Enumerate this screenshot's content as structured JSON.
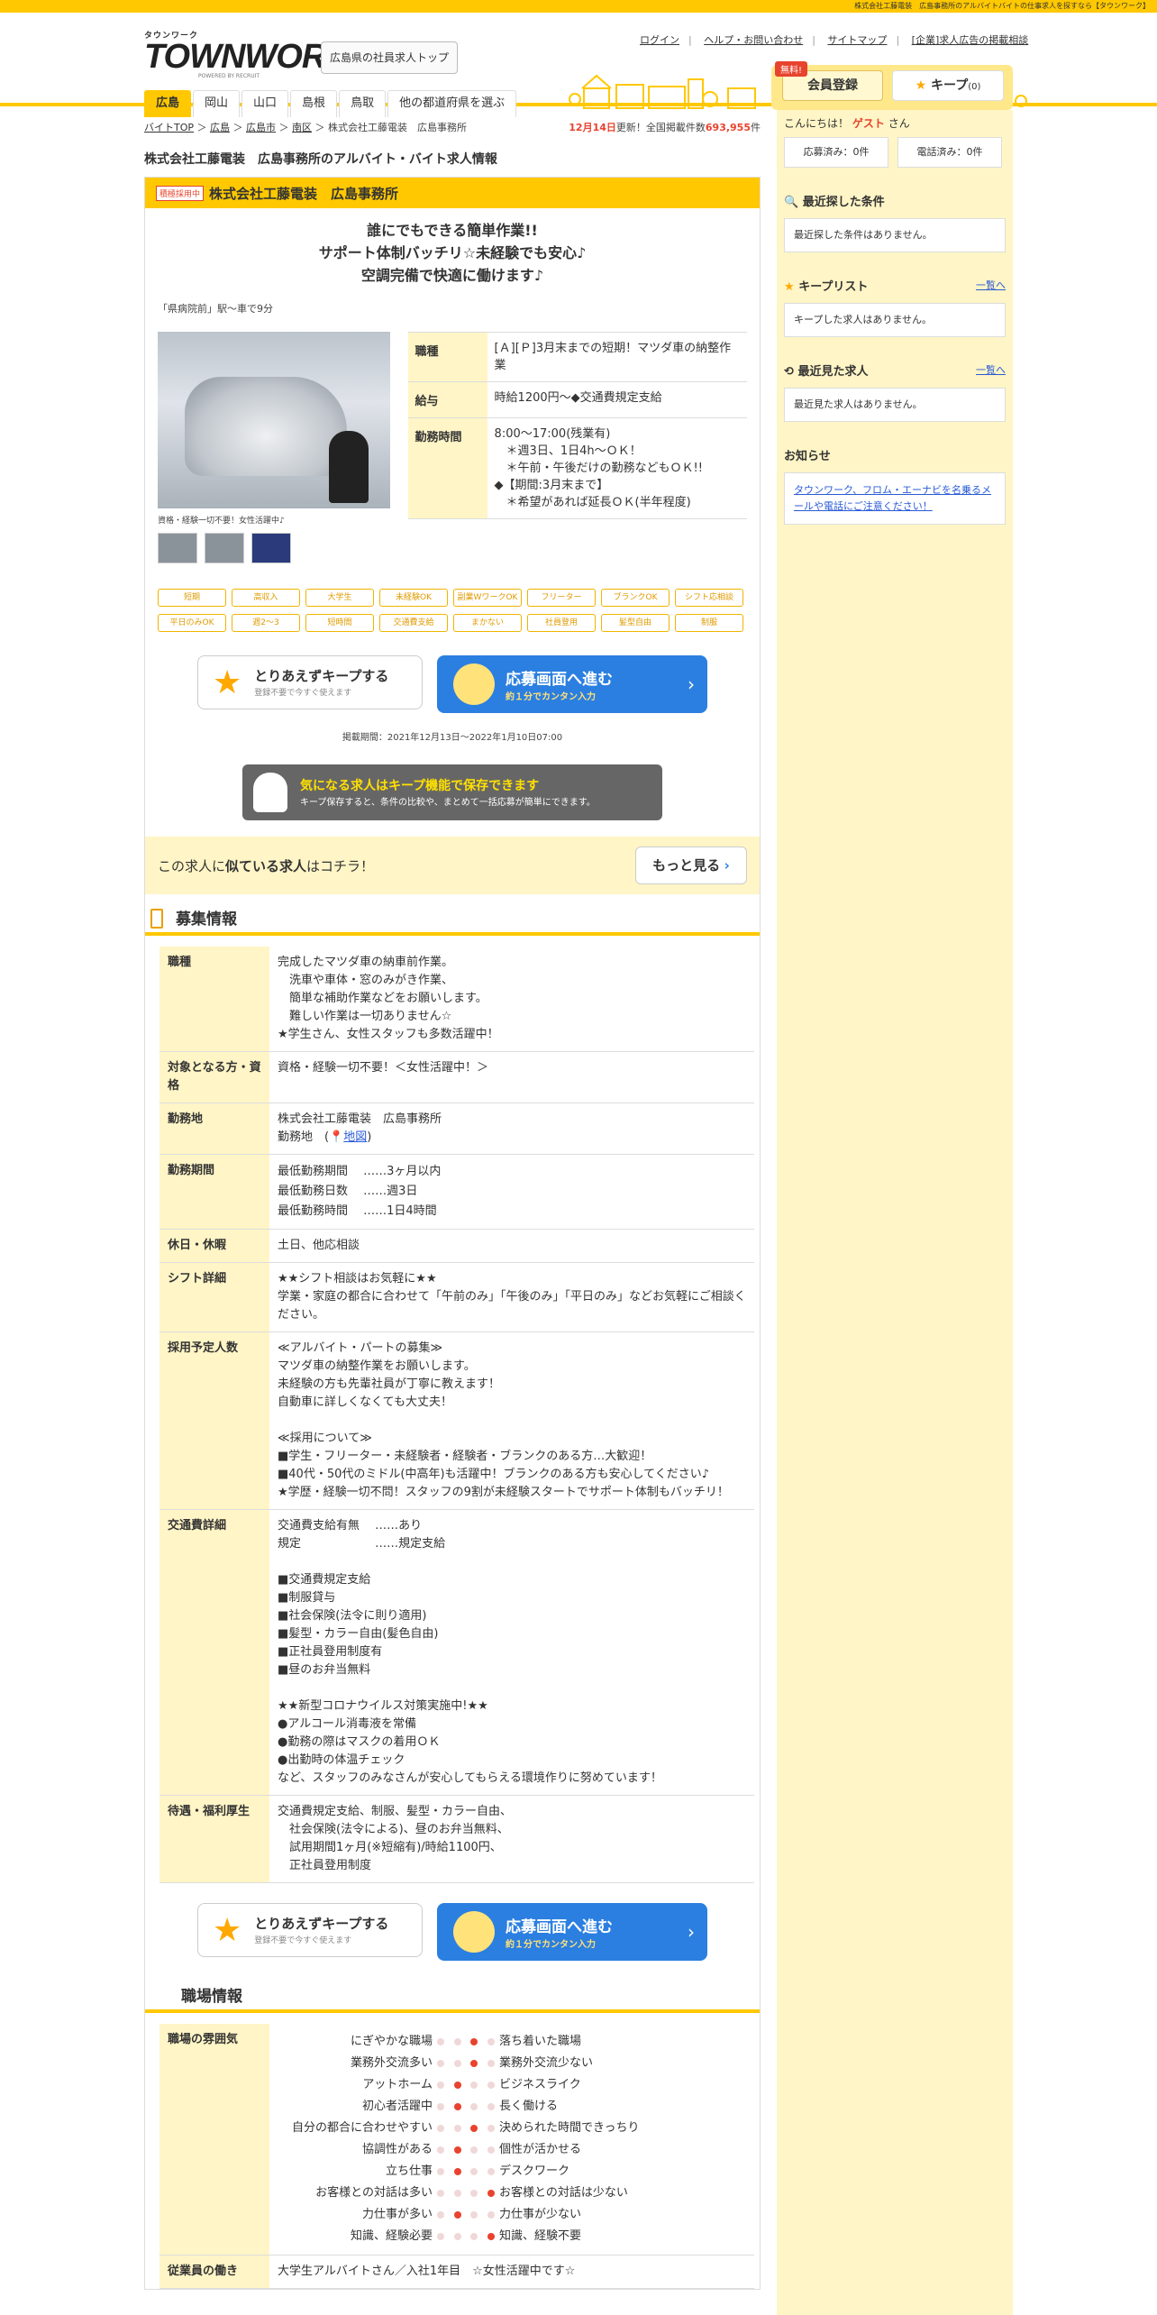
{
  "topbar": "株式会社工藤電装　広島事務所のアルバイトバイトの仕事求人を探すなら【タウンワーク】",
  "logo": {
    "small": "タウンワーク",
    "big": "TOWNWORK",
    "pw": "POWERED BY RECRUIT"
  },
  "header": {
    "top_button": "広島県の社員求人トップ",
    "links": [
      "ログイン",
      "ヘルプ・お問い合わせ",
      "サイトマップ",
      "[企業]求人広告の掲載相談"
    ],
    "tabs": [
      "広島",
      "岡山",
      "山口",
      "島根",
      "鳥取",
      "他の都道府県を選ぶ"
    ],
    "free": "無料!",
    "register": "会員登録",
    "keep": "キープ",
    "keep_count": "(0)"
  },
  "breadcrumb": [
    "バイトTOP",
    "広島",
    "広島市",
    "南区",
    "株式会社工藤電装　広島事務所"
  ],
  "update": {
    "date": "12月14日",
    "mid": "更新！全国掲載件数",
    "count": "693,955",
    "suffix": "件"
  },
  "page_title": "株式会社工藤電装　広島事務所のアルバイト・バイト求人情報",
  "job": {
    "badge": "積極採用中",
    "company": "株式会社工藤電装　広島事務所",
    "catch": [
      "誰にでもできる簡単作業!!",
      "サポート体制バッチリ☆未経験でも安心♪",
      "空調完備で快適に働けます♪"
    ],
    "station": "「県病院前」駅～車で9分",
    "photo_caption": "資格・経験一切不要！女性活躍中♪",
    "spec": [
      {
        "k": "職種",
        "v": "[Ａ][Ｐ]3月末までの短期！マツダ車の納整作業"
      },
      {
        "k": "給与",
        "v": "時給1200円～◆交通費規定支給"
      },
      {
        "k": "勤務時間",
        "v": "8:00～17:00(残業有)\n　＊週3日、1日4h～ＯＫ！\n　＊午前・午後だけの勤務などもＯＫ!!\n◆【期間:3月末まで】\n　＊希望があれば延長ＯＫ(半年程度)"
      }
    ],
    "tags": [
      "短期",
      "高収入",
      "大学生",
      "未経験OK",
      "副業WワークOK",
      "フリーター",
      "ブランクOK",
      "シフト応相談",
      "平日のみOK",
      "週2～3",
      "短時間",
      "交通費支給",
      "まかない",
      "社員登用",
      "髪型自由",
      "制服"
    ],
    "keep_btn": {
      "title": "とりあえずキープする",
      "sub": "登録不要で今すぐ使えます"
    },
    "apply_btn": {
      "title": "応募画面へ進む",
      "sub": "約１分でカンタン入力"
    },
    "period": "掲載期間：2021年12月13日～2022年1月10日07:00",
    "banner": {
      "title": "気になる求人はキープ機能で保存できます",
      "sub": "キープ保存すると、条件の比較や、まとめて一括応募が簡単にできます。"
    },
    "similar": {
      "pre": "この求人に",
      "bold": "似ている求人",
      "post": "はコチラ！",
      "more": "もっと見る"
    }
  },
  "recruit": {
    "title": "募集情報",
    "rows": [
      {
        "k": "職種",
        "v": "完成したマツダ車の納車前作業。\n　洗車や車体・窓のみがき作業、\n　簡単な補助作業などをお願いします。\n　難しい作業は一切ありません☆\n★学生さん、女性スタッフも多数活躍中！"
      },
      {
        "k": "対象となる方・資格",
        "v": "資格・経験一切不要！＜女性活躍中！＞"
      },
      {
        "k": "勤務地",
        "v": "株式会社工藤電装　広島事務所"
      },
      {
        "k": "勤務期間",
        "v": "最低勤務期間　 ……3ヶ月以内\n最低勤務日数　 ……週3日\n最低勤務時間　 ……1日4時間"
      },
      {
        "k": "休日・休暇",
        "v": "土日、他応相談"
      },
      {
        "k": "シフト詳細",
        "v": "★★シフト相談はお気軽に★★\n学業・家庭の都合に合わせて「午前のみ」「午後のみ」「平日のみ」などお気軽にご相談ください。"
      },
      {
        "k": "採用予定人数",
        "v": "≪アルバイト・パートの募集≫\nマツダ車の納整作業をお願いします。\n未経験の方も先輩社員が丁寧に教えます！\n自動車に詳しくなくても大丈夫！\n\n≪採用について≫\n■学生・フリーター・未経験者・経験者・ブランクのある方…大歓迎！\n■40代・50代のミドル(中高年)も活躍中！ブランクのある方も安心してください♪\n★学歴・経験一切不問！スタッフの9割が未経験スタートでサポート体制もバッチリ！"
      },
      {
        "k": "交通費詳細",
        "v": "交通費支給有無　 ……あり\n規定　　　　　　 ……規定支給\n\n■交通費規定支給\n■制服貸与\n■社会保険(法令に則り適用)\n■髪型・カラー自由(髪色自由)\n■正社員登用制度有\n■昼のお弁当無料\n\n★★新型コロナウイルス対策実施中!★★\n●アルコール消毒液を常備\n●勤務の際はマスクの着用ＯＫ\n●出勤時の体温チェック\nなど、スタッフのみなさんが安心してもらえる環境作りに努めています！"
      },
      {
        "k": "待遇・福利厚生",
        "v": "交通費規定支給、制服、髪型・カラー自由、\n　社会保険(法令による)、昼のお弁当無料、\n　試用期間1ヶ月(※短縮有)/時給1100円、\n　正社員登用制度"
      }
    ],
    "map_prefix": "勤務地　(",
    "map_link": "地図",
    "map_suffix": ")"
  },
  "workplace": {
    "title": "職場情報",
    "atmo_label": "職場の雰囲気",
    "atmo": [
      {
        "l": "にぎやかな職場",
        "r": "落ち着いた職場",
        "pos": 2
      },
      {
        "l": "業務外交流多い",
        "r": "業務外交流少ない",
        "pos": 2
      },
      {
        "l": "アットホーム",
        "r": "ビジネスライク",
        "pos": 1
      },
      {
        "l": "初心者活躍中",
        "r": "長く働ける",
        "pos": 1
      },
      {
        "l": "自分の都合に合わせやすい",
        "r": "決められた時間できっちり",
        "pos": 2
      },
      {
        "l": "協調性がある",
        "r": "個性が活かせる",
        "pos": 1
      },
      {
        "l": "立ち仕事",
        "r": "デスクワーク",
        "pos": 1
      },
      {
        "l": "お客様との対話は多い",
        "r": "お客様との対話は少ない",
        "pos": 3
      },
      {
        "l": "力仕事が多い",
        "r": "力仕事が少ない",
        "pos": 1
      },
      {
        "l": "知識、経験必要",
        "r": "知識、経験不要",
        "pos": 3
      }
    ],
    "staff_label": "従業員の働き",
    "staff": "大学生アルバイトさん／入社1年目　☆女性活躍中です☆"
  },
  "sidebar": {
    "hello_pre": "こんにちは！",
    "guest": "ゲスト",
    "hello_post": "さん",
    "applied": "応募済み：0件",
    "called": "電話済み：0件",
    "recent_search": "最近探した条件",
    "recent_search_empty": "最近探した条件はありません。",
    "keeplist": "キープリスト",
    "keeplist_link": "一覧へ",
    "keeplist_empty": "キープした求人はありません。",
    "recent_view": "最近見た求人",
    "recent_view_link": "一覧へ",
    "recent_view_empty": "最近見た求人はありません。",
    "news": "お知らせ",
    "news_link": "タウンワーク、フロム・エーナビを名乗るメールや電話にご注意ください！"
  },
  "colors": {
    "accent": "#ffc800",
    "apply": "#2b7fe0",
    "warn": "#e8432e",
    "pale": "#fff5c6"
  }
}
